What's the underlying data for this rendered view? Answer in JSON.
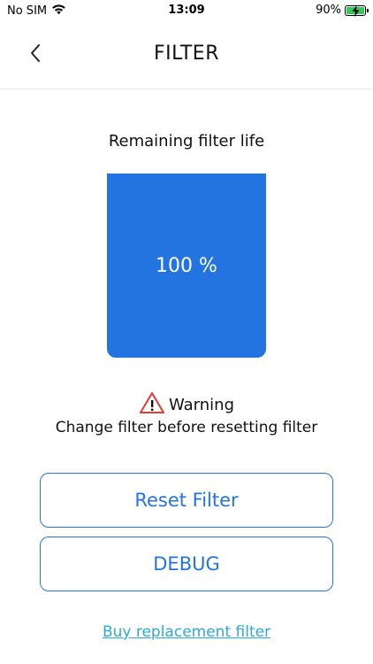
{
  "status_bar": {
    "carrier": "No SIM",
    "time": "13:09",
    "battery": "90%",
    "icons": [
      "wifi-icon",
      "battery-charging-icon"
    ]
  },
  "header": {
    "title": "FILTER",
    "back_icon": "chevron-left-icon"
  },
  "filter": {
    "label": "Remaining filter life",
    "value": "100 %",
    "level_percent": 100,
    "color": "#2374e1"
  },
  "warning": {
    "icon": "warning-triangle-icon",
    "title": "Warning",
    "message": "Change filter before resetting filter"
  },
  "buttons": {
    "reset_label": "Reset Filter",
    "debug_label": "DEBUG"
  },
  "link": {
    "buy_label": "Buy replacement filter"
  },
  "colors": {
    "accent": "#2374e1",
    "link": "#2fa9d6",
    "warning": "#e53935",
    "battery": "#34c759"
  }
}
